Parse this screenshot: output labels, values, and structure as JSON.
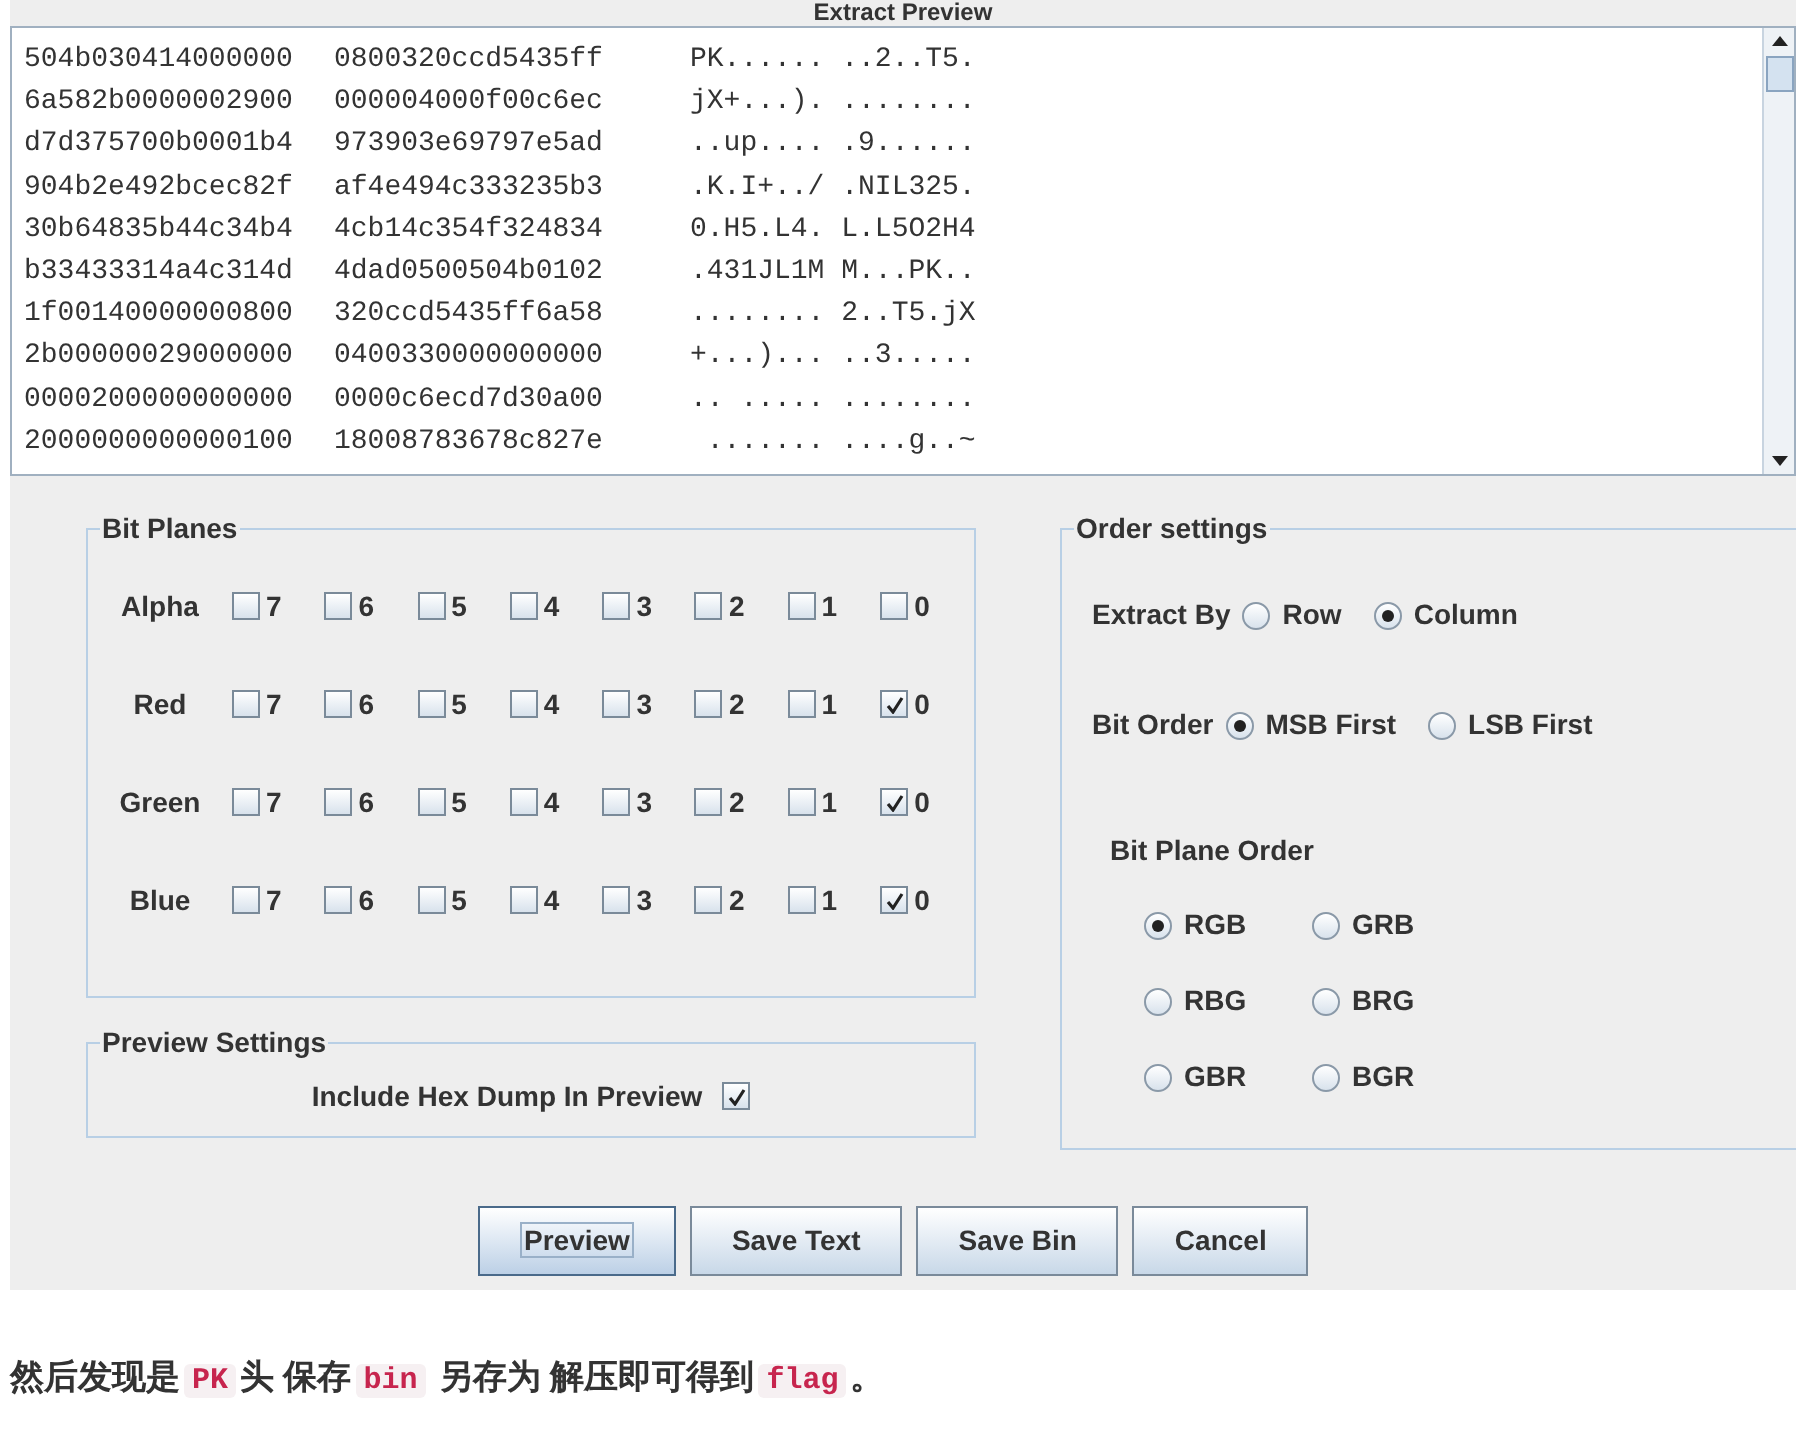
{
  "preview": {
    "title": "Extract Preview",
    "lines": [
      {
        "hex1": "504b030414000000",
        "hex2": "0800320ccd5435ff",
        "ascii": "PK...... ..2..T5."
      },
      {
        "hex1": "6a582b0000002900",
        "hex2": "000004000f00c6ec",
        "ascii": "jX+...). ........"
      },
      {
        "hex1": "d7d375700b0001b4",
        "hex2": "973903e69797e5ad",
        "ascii": "..up.... .9......"
      },
      {
        "hex1": "904b2e492bcec82f",
        "hex2": "af4e494c333235b3",
        "ascii": ".K.I+../ .NIL325."
      },
      {
        "hex1": "30b64835b44c34b4",
        "hex2": "4cb14c354f324834",
        "ascii": "0.H5.L4. L.L5O2H4"
      },
      {
        "hex1": "b33433314a4c314d",
        "hex2": "4dad0500504b0102",
        "ascii": ".431JL1M M...PK.."
      },
      {
        "hex1": "1f00140000000800",
        "hex2": "320ccd5435ff6a58",
        "ascii": "........ 2..T5.jX"
      },
      {
        "hex1": "2b00000029000000",
        "hex2": "0400330000000000",
        "ascii": "+...)... ..3....."
      },
      {
        "hex1": "0000200000000000",
        "hex2": "0000c6ecd7d30a00",
        "ascii": ".. ..... ........"
      },
      {
        "hex1": "2000000000000100",
        "hex2": "18008783678c827e",
        "ascii": " ....... ....g..~"
      }
    ]
  },
  "bit_planes": {
    "title": "Bit Planes",
    "channels": [
      {
        "name": "Alpha",
        "bits": [
          {
            "label": "7",
            "checked": false
          },
          {
            "label": "6",
            "checked": false
          },
          {
            "label": "5",
            "checked": false
          },
          {
            "label": "4",
            "checked": false
          },
          {
            "label": "3",
            "checked": false
          },
          {
            "label": "2",
            "checked": false
          },
          {
            "label": "1",
            "checked": false
          },
          {
            "label": "0",
            "checked": false
          }
        ]
      },
      {
        "name": "Red",
        "bits": [
          {
            "label": "7",
            "checked": false
          },
          {
            "label": "6",
            "checked": false
          },
          {
            "label": "5",
            "checked": false
          },
          {
            "label": "4",
            "checked": false
          },
          {
            "label": "3",
            "checked": false
          },
          {
            "label": "2",
            "checked": false
          },
          {
            "label": "1",
            "checked": false
          },
          {
            "label": "0",
            "checked": true
          }
        ]
      },
      {
        "name": "Green",
        "bits": [
          {
            "label": "7",
            "checked": false
          },
          {
            "label": "6",
            "checked": false
          },
          {
            "label": "5",
            "checked": false
          },
          {
            "label": "4",
            "checked": false
          },
          {
            "label": "3",
            "checked": false
          },
          {
            "label": "2",
            "checked": false
          },
          {
            "label": "1",
            "checked": false
          },
          {
            "label": "0",
            "checked": true
          }
        ]
      },
      {
        "name": "Blue",
        "bits": [
          {
            "label": "7",
            "checked": false
          },
          {
            "label": "6",
            "checked": false
          },
          {
            "label": "5",
            "checked": false
          },
          {
            "label": "4",
            "checked": false
          },
          {
            "label": "3",
            "checked": false
          },
          {
            "label": "2",
            "checked": false
          },
          {
            "label": "1",
            "checked": false
          },
          {
            "label": "0",
            "checked": true
          }
        ]
      }
    ]
  },
  "preview_settings": {
    "title": "Preview Settings",
    "label": "Include Hex Dump In Preview",
    "checked": true
  },
  "order_settings": {
    "title": "Order settings",
    "extract_by": {
      "label": "Extract By",
      "options": [
        {
          "label": "Row",
          "selected": false
        },
        {
          "label": "Column",
          "selected": true
        }
      ]
    },
    "bit_order": {
      "label": "Bit Order",
      "options": [
        {
          "label": "MSB First",
          "selected": true
        },
        {
          "label": "LSB First",
          "selected": false
        }
      ]
    },
    "plane_order": {
      "label": "Bit Plane Order",
      "options": [
        {
          "label": "RGB",
          "selected": true
        },
        {
          "label": "GRB",
          "selected": false
        },
        {
          "label": "RBG",
          "selected": false
        },
        {
          "label": "BRG",
          "selected": false
        },
        {
          "label": "GBR",
          "selected": false
        },
        {
          "label": "BGR",
          "selected": false
        }
      ]
    }
  },
  "buttons": [
    {
      "label": "Preview",
      "focused": true
    },
    {
      "label": "Save Text",
      "focused": false
    },
    {
      "label": "Save Bin",
      "focused": false
    },
    {
      "label": "Cancel",
      "focused": false
    }
  ],
  "caption": [
    {
      "kind": "text",
      "text": "然后发现是"
    },
    {
      "kind": "code",
      "text": "PK"
    },
    {
      "kind": "text",
      "text": "头 保存"
    },
    {
      "kind": "code",
      "text": "bin"
    },
    {
      "kind": "text",
      "text": " 另存为 解压即可得到"
    },
    {
      "kind": "code",
      "text": "flag"
    },
    {
      "kind": "text",
      "text": "。"
    }
  ]
}
